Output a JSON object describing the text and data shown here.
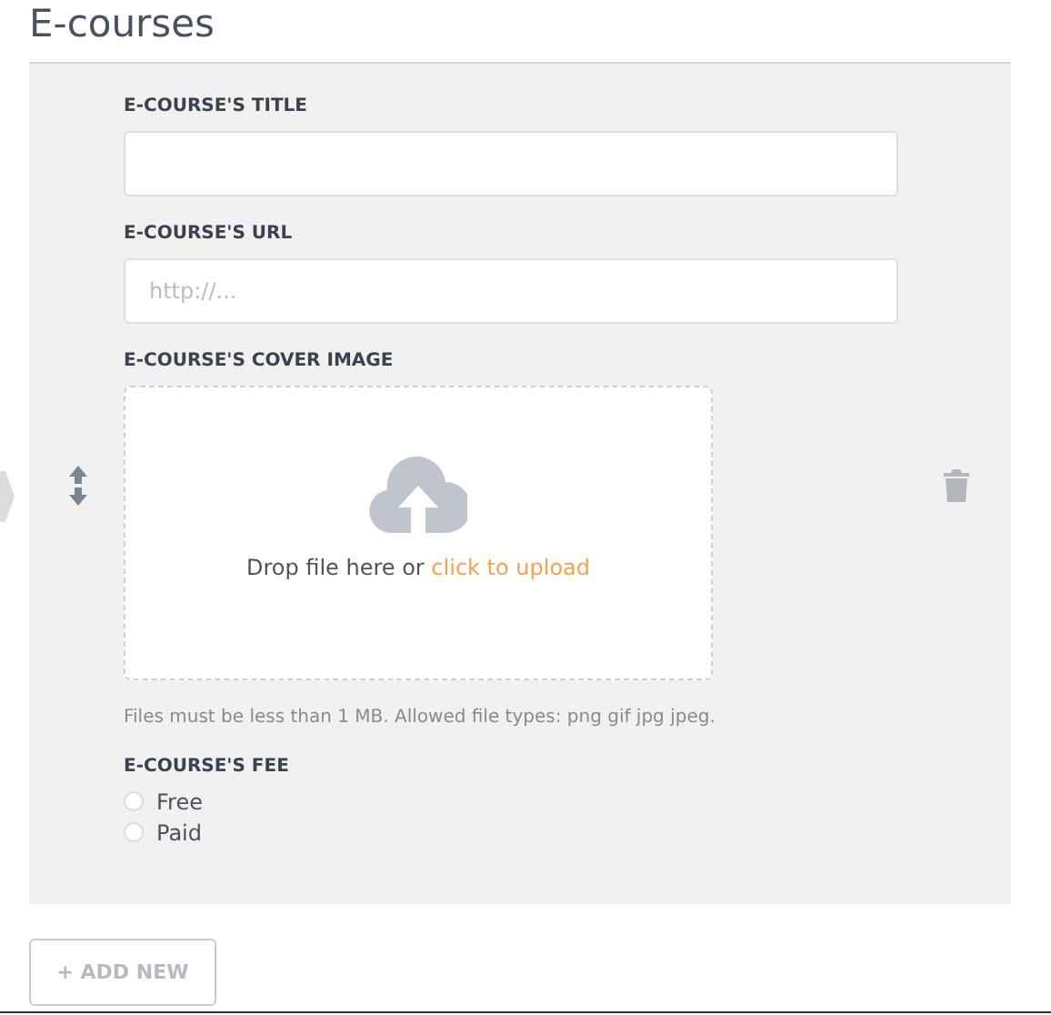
{
  "heading": "E-courses",
  "fields": [
    {
      "label": "E-COURSE'S TITLE"
    },
    {
      "label": "E-COURSE'S URL",
      "placeholder": "http://..."
    }
  ],
  "cover": {
    "label": "E-COURSE'S COVER IMAGE",
    "drop_text": "Drop file here or",
    "link": "click to upload",
    "hint": "Files must be less than 1 MB. Allowed file types: png gif jpg jpeg."
  },
  "fee": {
    "label": "E-COURSE'S FEE",
    "options": [
      {
        "label": "Free",
        "selected": false
      },
      {
        "label": "Paid",
        "selected": false
      }
    ]
  },
  "add_button": "+ ADD NEW"
}
